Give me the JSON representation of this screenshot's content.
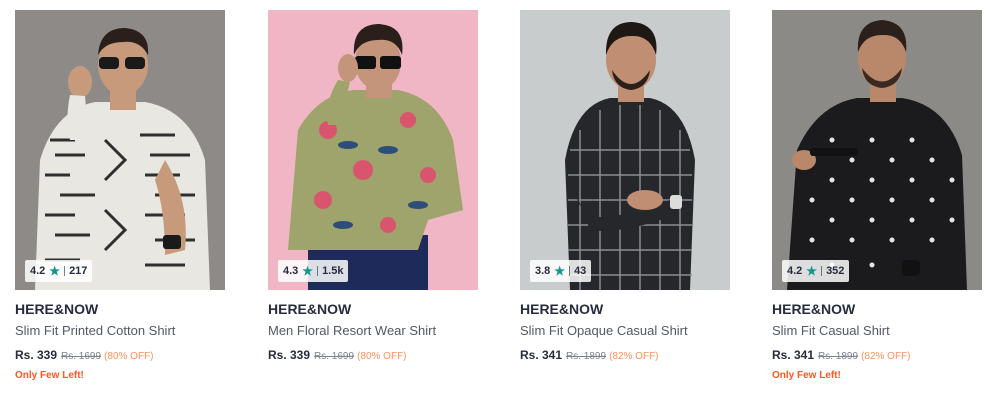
{
  "products": [
    {
      "brand": "HERE&NOW",
      "name": "Slim Fit Printed Cotton Shirt",
      "rating": "4.2",
      "rating_count": "217",
      "price": "Rs. 339",
      "mrp": "Rs. 1699",
      "discount": "(80% OFF)",
      "stock_note": "Only Few Left!",
      "background_color": "#8d8a87",
      "shirt_color": "#e9e7e2",
      "pattern_color": "#2f2f2f"
    },
    {
      "brand": "HERE&NOW",
      "name": "Men Floral Resort Wear Shirt",
      "rating": "4.3",
      "rating_count": "1.5k",
      "price": "Rs. 339",
      "mrp": "Rs. 1699",
      "discount": "(80% OFF)",
      "stock_note": "",
      "background_color": "#f1b6c6",
      "shirt_color": "#9fa36c",
      "pattern_color": "#d9556e"
    },
    {
      "brand": "HERE&NOW",
      "name": "Slim Fit Opaque Casual Shirt",
      "rating": "3.8",
      "rating_count": "43",
      "price": "Rs. 341",
      "mrp": "Rs. 1899",
      "discount": "(82% OFF)",
      "stock_note": "",
      "background_color": "#c9cccc",
      "shirt_color": "#26272b",
      "pattern_color": "#8a8d93"
    },
    {
      "brand": "HERE&NOW",
      "name": "Slim Fit Casual Shirt",
      "rating": "4.2",
      "rating_count": "352",
      "price": "Rs. 341",
      "mrp": "Rs. 1899",
      "discount": "(82% OFF)",
      "stock_note": "Only Few Left!",
      "background_color": "#8c8a87",
      "shirt_color": "#1b1b1d",
      "pattern_color": "#e6e6e6"
    }
  ],
  "icons": {
    "rating_star": "star-icon"
  }
}
